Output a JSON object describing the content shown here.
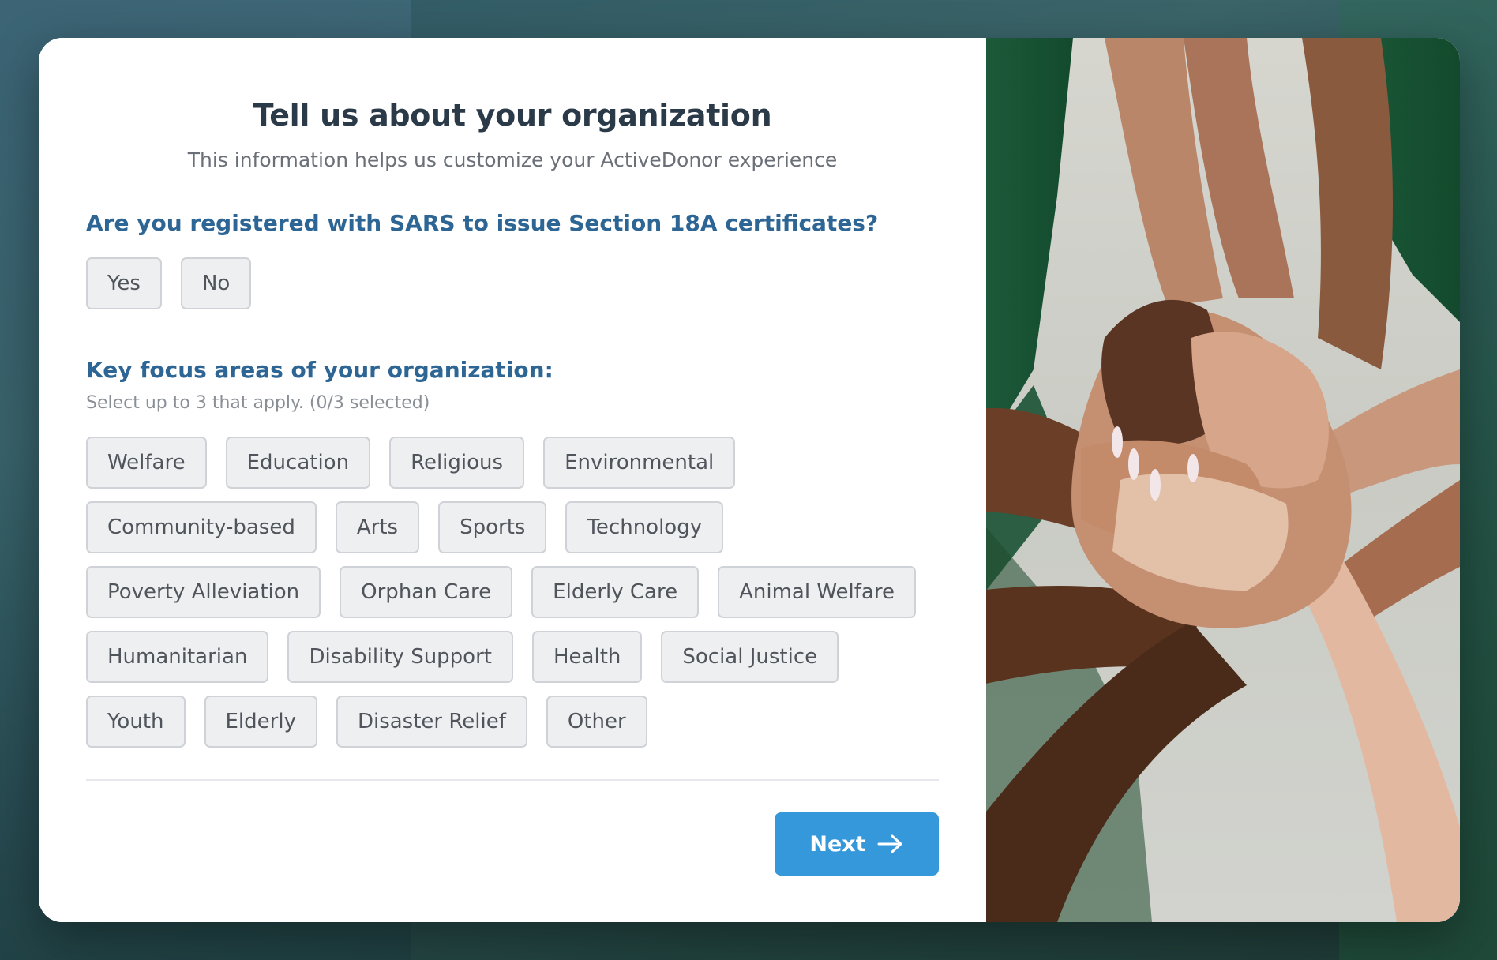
{
  "form": {
    "title": "Tell us about your organization",
    "subtitle": "This information helps us customize your ActiveDonor experience",
    "sars_question": "Are you registered with SARS to issue Section 18A certificates?",
    "yes_label": "Yes",
    "no_label": "No",
    "focus_question": "Key focus areas of your organization:",
    "focus_hint": "Select up to 3 that apply. (0/3 selected)",
    "focus_areas": [
      [
        "Welfare",
        "Education",
        "Religious",
        "Environmental"
      ],
      [
        "Community-based",
        "Arts",
        "Sports",
        "Technology"
      ],
      [
        "Poverty Alleviation",
        "Orphan Care",
        "Elderly Care",
        "Animal Welfare"
      ],
      [
        "Humanitarian",
        "Disability Support",
        "Health",
        "Social Justice"
      ],
      [
        "Youth",
        "Elderly",
        "Disaster Relief",
        "Other"
      ]
    ],
    "next_label": "Next"
  },
  "colors": {
    "heading_blue": "#2d6594",
    "button_blue": "#3498db",
    "chip_bg": "#eeeff1",
    "chip_border": "#cfd2d6"
  },
  "icons": {
    "next_icon": "arrow-right-icon"
  }
}
